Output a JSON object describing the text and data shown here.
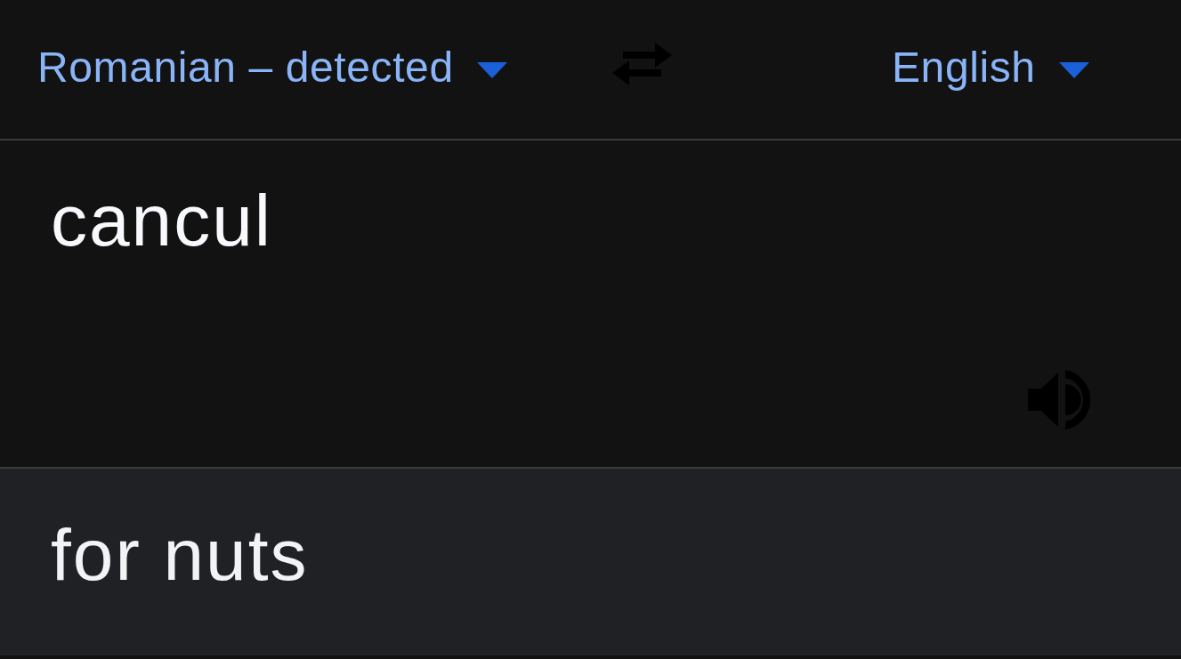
{
  "source_language": {
    "label": "Romanian – detected"
  },
  "target_language": {
    "label": "English"
  },
  "input": {
    "value": "cancul"
  },
  "output": {
    "text": "for nuts"
  }
}
